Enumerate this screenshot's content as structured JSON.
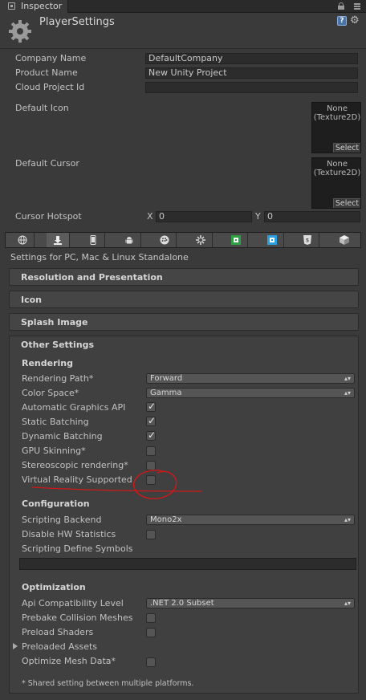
{
  "tab": {
    "label": "Inspector"
  },
  "header": {
    "title": "PlayerSettings"
  },
  "company": {
    "label": "Company Name",
    "value": "DefaultCompany"
  },
  "product": {
    "label": "Product Name",
    "value": "New Unity Project"
  },
  "cloud": {
    "label": "Cloud Project Id",
    "value": ""
  },
  "default_icon": {
    "label": "Default Icon",
    "line1": "None",
    "line2": "(Texture2D)",
    "select": "Select"
  },
  "default_cursor": {
    "label": "Default Cursor",
    "line1": "None",
    "line2": "(Texture2D)",
    "select": "Select"
  },
  "cursor_hotspot": {
    "label": "Cursor Hotspot",
    "x_label": "X",
    "x_value": "0",
    "y_label": "Y",
    "y_value": "0"
  },
  "platforms": {
    "icons": [
      "globe-icon",
      "download-icon",
      "phone-icon",
      "android-icon",
      "blackberry-icon",
      "tizen-icon",
      "xbox-icon",
      "windows-store-icon",
      "html5-icon",
      "cube-icon"
    ],
    "active_index": 1
  },
  "settings_for": "Settings for PC, Mac & Linux Standalone",
  "sections": {
    "resolution": "Resolution and Presentation",
    "icon": "Icon",
    "splash": "Splash Image",
    "other": "Other Settings"
  },
  "rendering": {
    "heading": "Rendering",
    "rendering_path": {
      "label": "Rendering Path*",
      "value": "Forward"
    },
    "color_space": {
      "label": "Color Space*",
      "value": "Gamma"
    },
    "auto_graphics": {
      "label": "Automatic Graphics API",
      "checked": true
    },
    "static_batching": {
      "label": "Static Batching",
      "checked": true
    },
    "dynamic_batching": {
      "label": "Dynamic Batching",
      "checked": true
    },
    "gpu_skinning": {
      "label": "GPU Skinning*",
      "checked": false
    },
    "stereoscopic": {
      "label": "Stereoscopic rendering*",
      "checked": false
    },
    "vr_supported": {
      "label": "Virtual Reality Supported",
      "checked": false
    }
  },
  "configuration": {
    "heading": "Configuration",
    "scripting_backend": {
      "label": "Scripting Backend",
      "value": "Mono2x"
    },
    "disable_hw_stats": {
      "label": "Disable HW Statistics",
      "checked": false
    },
    "define_symbols": {
      "label": "Scripting Define Symbols",
      "value": ""
    }
  },
  "optimization": {
    "heading": "Optimization",
    "api_level": {
      "label": "Api Compatibility Level",
      "value": ".NET 2.0 Subset"
    },
    "prebake": {
      "label": "Prebake Collision Meshes",
      "checked": false
    },
    "preload_shaders": {
      "label": "Preload Shaders",
      "checked": false
    },
    "preloaded_assets": {
      "label": "Preloaded Assets"
    },
    "optimize_mesh": {
      "label": "Optimize Mesh Data*",
      "checked": false
    }
  },
  "footnote": "* Shared setting between multiple platforms.",
  "annotation_color": "#d01818"
}
